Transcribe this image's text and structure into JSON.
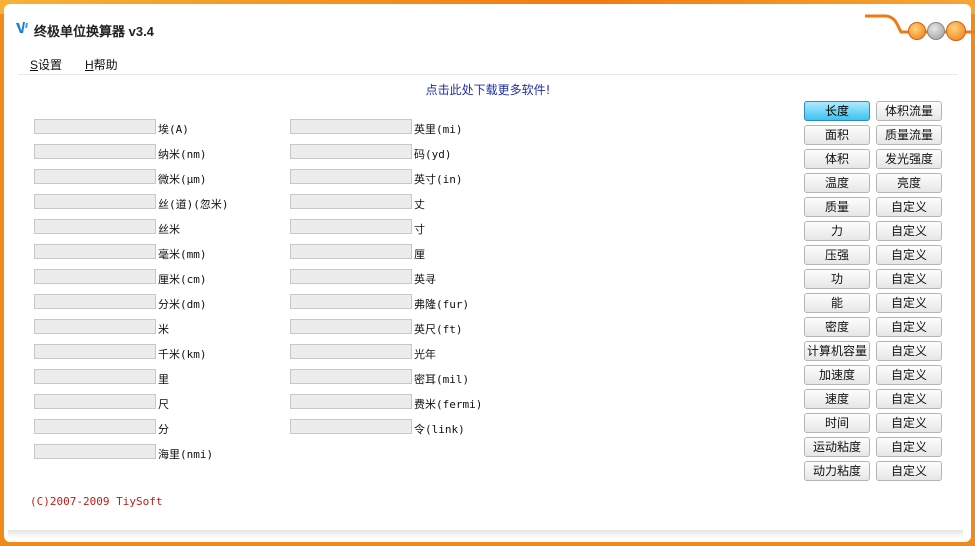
{
  "window": {
    "title": "终极单位换算器 v3.4"
  },
  "menu": [
    {
      "hotkey": "S",
      "rest": "设置"
    },
    {
      "hotkey": "H",
      "rest": "帮助"
    }
  ],
  "promo_link": "点击此处下载更多软件!",
  "left_units": [
    "埃(A)",
    "纳米(nm)",
    "微米(μm)",
    "丝(道)(忽米)",
    "丝米",
    "毫米(mm)",
    "厘米(cm)",
    "分米(dm)",
    "米",
    "千米(km)",
    "里",
    "尺",
    "分",
    "海里(nmi)"
  ],
  "right_units": [
    "英里(mi)",
    "码(yd)",
    "英寸(in)",
    "丈",
    "寸",
    "厘",
    "英寻",
    "弗隆(fur)",
    "英尺(ft)",
    "光年",
    "密耳(mil)",
    "费米(fermi)",
    "令(link)"
  ],
  "categories_left": [
    "长度",
    "面积",
    "体积",
    "温度",
    "质量",
    "力",
    "压强",
    "功",
    "能",
    "密度",
    "计算机容量",
    "加速度",
    "速度",
    "时间",
    "运动粘度",
    "动力粘度"
  ],
  "categories_right": [
    "体积流量",
    "质量流量",
    "发光强度",
    "亮度",
    "自定义",
    "自定义",
    "自定义",
    "自定义",
    "自定义",
    "自定义",
    "自定义",
    "自定义",
    "自定义",
    "自定义",
    "自定义",
    "自定义"
  ],
  "active_category": "长度",
  "copyright": "(C)2007-2009 TiySoft"
}
